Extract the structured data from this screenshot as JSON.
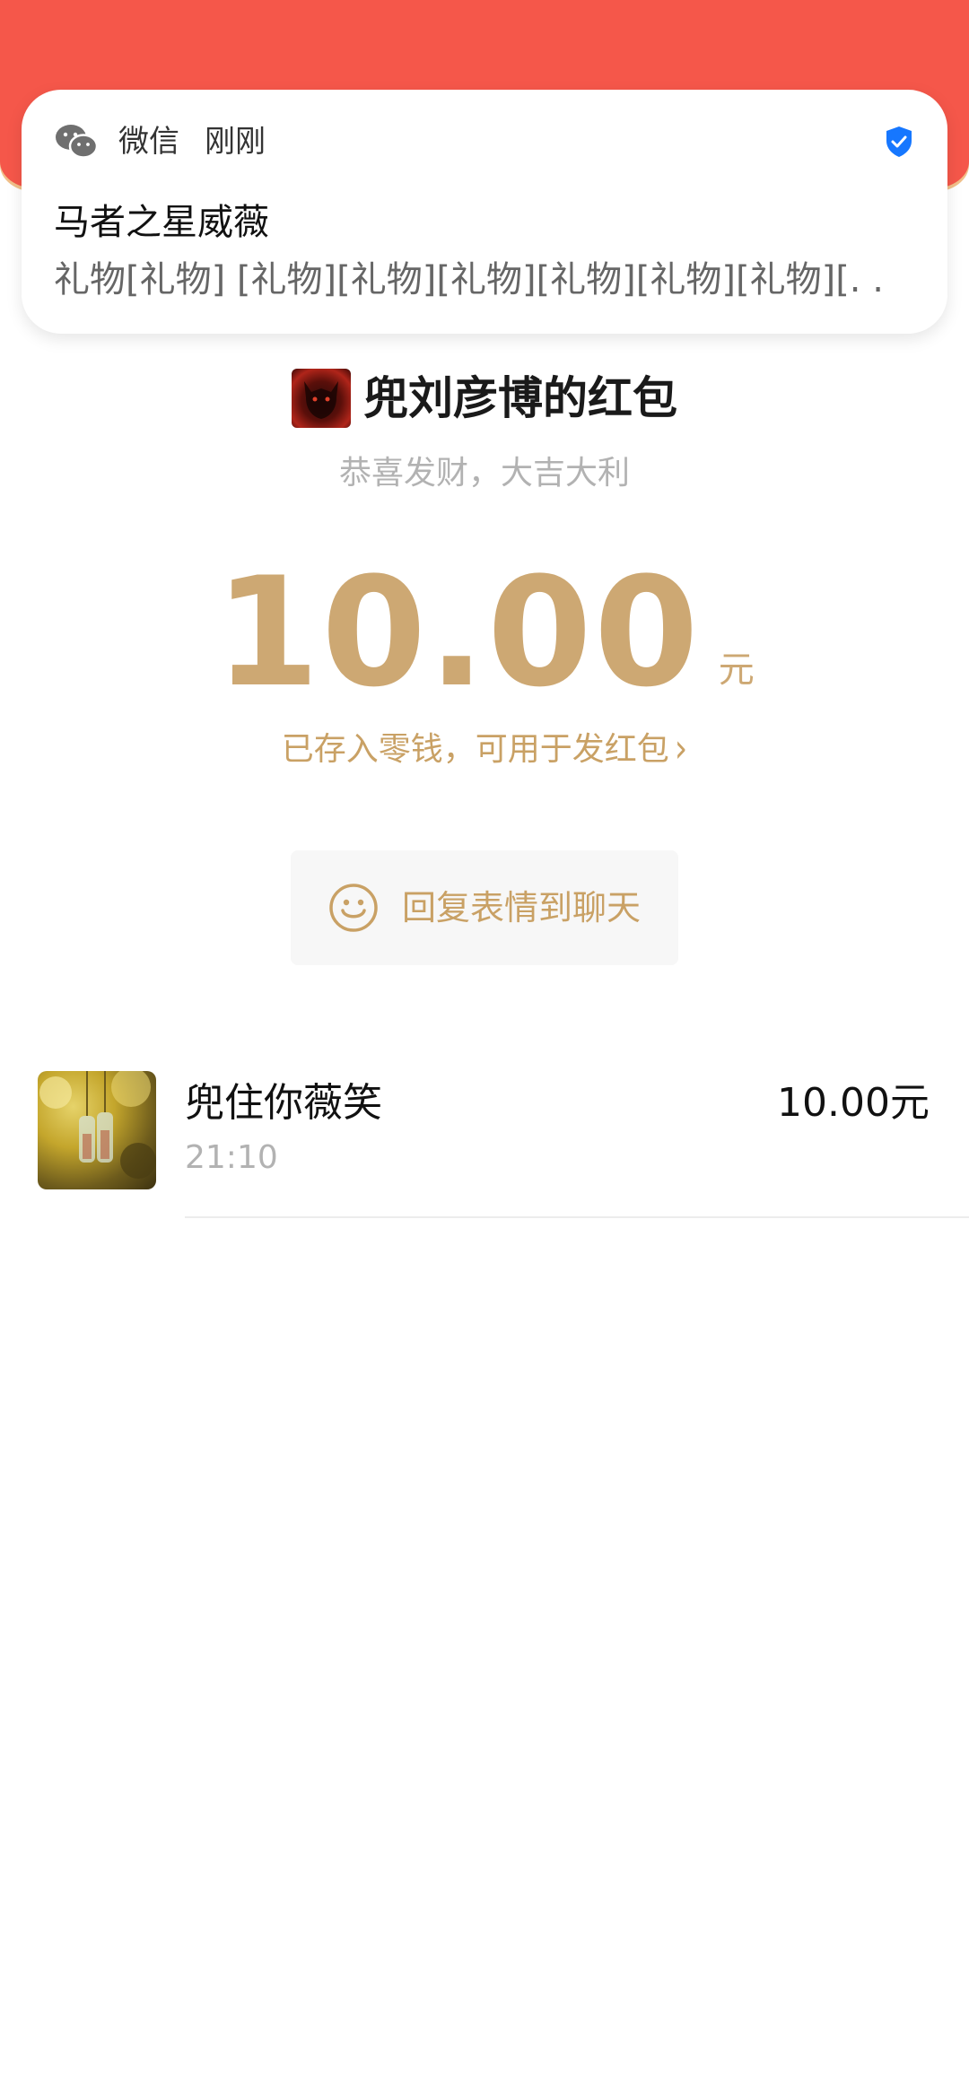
{
  "notification": {
    "app_name": "微信",
    "time": "刚刚",
    "title": "马者之星威薇",
    "body": "礼物[礼物] [礼物][礼物][礼物][礼物][礼物][礼物][. .",
    "app_icon": "wechat-icon",
    "badge_icon": "shield-check-icon"
  },
  "red_packet": {
    "sender_title": "兜刘彦博的红包",
    "wish": "恭喜发财，大吉大利",
    "amount": "10.00",
    "unit": "元",
    "saved_notice": "已存入零钱，可用于发红包",
    "saved_chevron": "›",
    "reply_button_label": "回复表情到聊天",
    "reply_icon": "smiley-icon"
  },
  "receivers": [
    {
      "name": "兜住你薇笑",
      "time": "21:10",
      "amount": "10.00元"
    }
  ],
  "colors": {
    "banner_red": "#f5574a",
    "gold": "#cda873",
    "verified_blue": "#1677ff"
  }
}
